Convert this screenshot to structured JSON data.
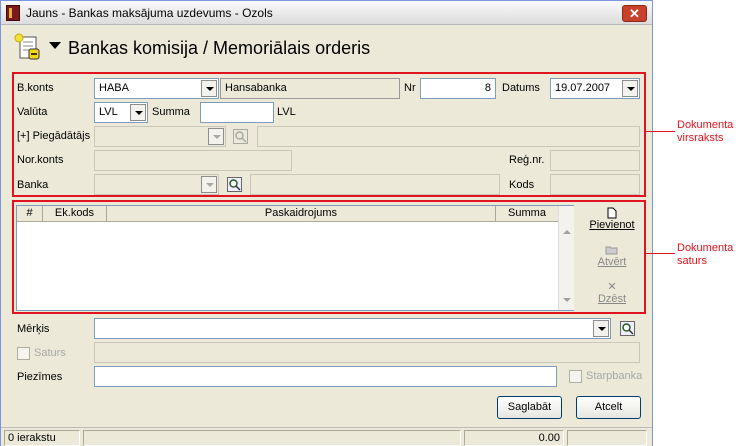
{
  "window": {
    "title": "Jauns - Bankas maksājuma uzdevums - Ozols",
    "close": "✕"
  },
  "doc_title": "Bankas komisija / Memoriālais orderis",
  "header": {
    "bkonts": {
      "label": "B.konts",
      "value": "HABA",
      "name": "Hansabanka"
    },
    "nr": {
      "label": "Nr",
      "value": "8"
    },
    "datums": {
      "label": "Datums",
      "value": "19.07.2007"
    },
    "valuta": {
      "label": "Valūta",
      "value": "LVL"
    },
    "summa": {
      "label": "Summa",
      "value": "",
      "currency": "LVL"
    },
    "piegadatajs": {
      "label": "[+] Piegādātājs",
      "value": ""
    },
    "norkonts": {
      "label": "Nor.konts"
    },
    "regnr": {
      "label": "Reģ.nr."
    },
    "banka": {
      "label": "Banka"
    },
    "kods": {
      "label": "Kods"
    }
  },
  "grid": {
    "columns": [
      "#",
      "Ek.kods",
      "Paskaidrojums",
      "Summa"
    ],
    "rows": []
  },
  "actions": {
    "add": "Pievienot",
    "open": "Atvērt",
    "delete": "Dzēst"
  },
  "footer": {
    "merkis": {
      "label": "Mērķis",
      "value": ""
    },
    "saturs": {
      "label": "Saturs"
    },
    "piezimes": {
      "label": "Piezīmes",
      "value": ""
    },
    "starpbanka": {
      "label": "Starpbanka"
    }
  },
  "buttons": {
    "save": "Saglabāt",
    "cancel": "Atcelt"
  },
  "status": {
    "records": "0 ierakstu",
    "total": "0.00"
  },
  "annotations": {
    "header_label": "Dokumenta virsraksts",
    "content_label": "Dokumenta saturs",
    "color": "#e0141e"
  }
}
